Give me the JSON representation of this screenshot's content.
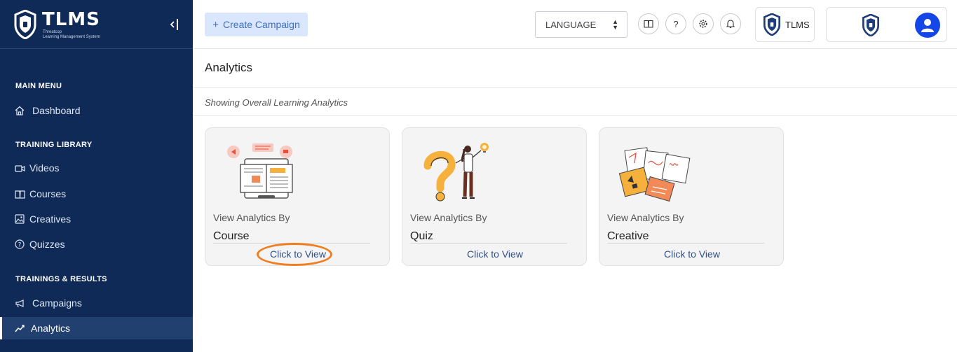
{
  "brand": {
    "title": "TLMS",
    "subtitle_line1": "Threatcop",
    "subtitle_line2": "Learning Management System"
  },
  "sidebar": {
    "main_menu": "MAIN MENU",
    "dashboard": "Dashboard",
    "training_library": "TRAINING LIBRARY",
    "videos": "Videos",
    "courses": "Courses",
    "creatives": "Creatives",
    "quizzes": "Quizzes",
    "trainings_results": "TRAININGS & RESULTS",
    "campaigns": "Campaigns",
    "analytics": "Analytics",
    "active_item": "Analytics"
  },
  "topbar": {
    "create_campaign": "Create Campaign",
    "language": "LANGUAGE",
    "org_name": "TLMS"
  },
  "main": {
    "title": "Analytics",
    "subtitle": "Showing Overall Learning Analytics",
    "cards": [
      {
        "by_label": "View Analytics By",
        "name": "Course",
        "cta": "Click to View"
      },
      {
        "by_label": "View Analytics By",
        "name": "Quiz",
        "cta": "Click to View"
      },
      {
        "by_label": "View Analytics By",
        "name": "Creative",
        "cta": "Click to View"
      }
    ]
  },
  "colors": {
    "sidebar_bg": "#0f2a56",
    "accent_blue": "#3d6fc4",
    "button_bg": "#d9e6fb",
    "highlight_ring": "#f07d1e",
    "avatar_bg": "#1446e8"
  },
  "icons": [
    "home-icon",
    "video-icon",
    "book-icon",
    "image-icon",
    "question-icon",
    "megaphone-icon",
    "chart-icon",
    "help-icon",
    "gear-icon",
    "bell-icon",
    "user-icon"
  ]
}
